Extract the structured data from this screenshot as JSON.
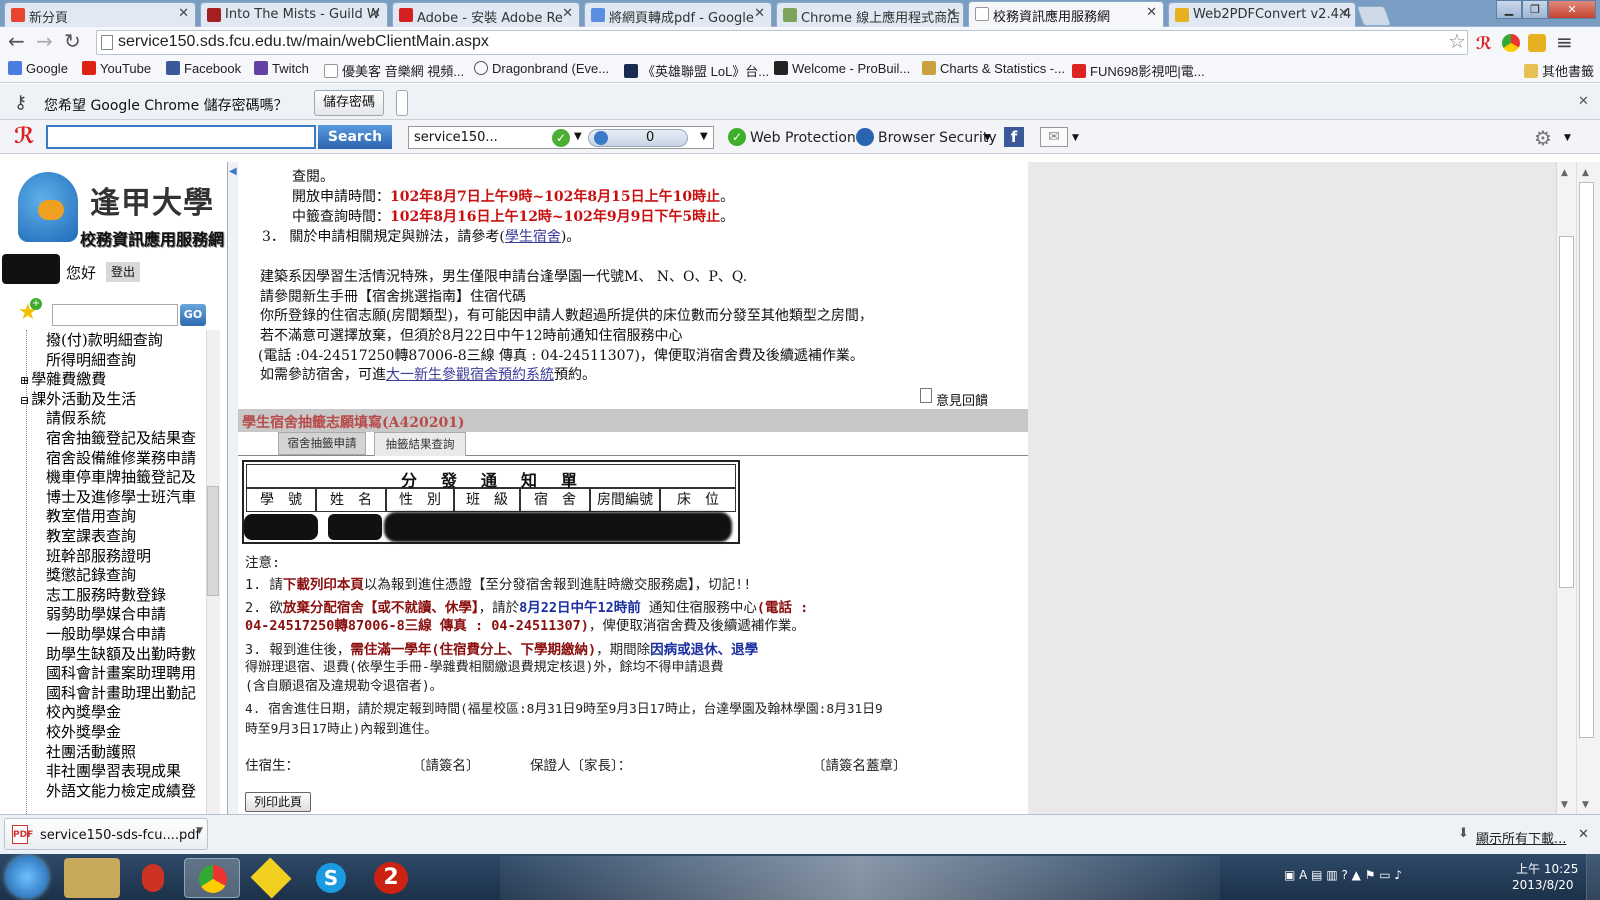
{
  "tabs": [
    {
      "title": "新分頁",
      "active": false
    },
    {
      "title": "Into The Mists - Guild W",
      "active": false
    },
    {
      "title": "Adobe - 安裝 Adobe Re",
      "active": false
    },
    {
      "title": "將網頁轉成pdf - Google",
      "active": false
    },
    {
      "title": "Chrome 線上應用程式商店",
      "active": false
    },
    {
      "title": "校務資訊應用服務網",
      "active": true
    },
    {
      "title": "Web2PDFConvert v2.4.4",
      "active": false
    }
  ],
  "address": {
    "url": "service150.sds.fcu.edu.tw/main/webClientMain.aspx"
  },
  "bookmarks": [
    "Google",
    "YouTube",
    "Facebook",
    "Twitch",
    "優美客 音樂網 視頻...",
    "Dragonbrand (Eve...",
    "《英雄聯盟 LoL》台...",
    "Welcome - ProBuil...",
    "Charts & Statistics -...",
    "FUN698影視吧|電...",
    "其他書籤"
  ],
  "password_bar": {
    "prompt": "您希望 Google Chrome 儲存密碼嗎？",
    "save_label": "儲存密碼"
  },
  "toolbar": {
    "search_label": "Search",
    "site_field": "service150...",
    "count": "0",
    "web_protection": "Web Protection",
    "browser_security": "Browser Security"
  },
  "sidebar": {
    "logo_text": "逢甲大學",
    "logo_subtitle": "校務資訊應用服務網",
    "greeting": "您好",
    "logout": "登出",
    "go_label": "GO",
    "tree_items": [
      {
        "label": "撥(付)款明細查詢",
        "type": "leaf"
      },
      {
        "label": "所得明細查詢",
        "type": "leaf"
      },
      {
        "label": "學雜費繳費",
        "type": "folder-closed"
      },
      {
        "label": "課外活動及生活",
        "type": "folder-open"
      },
      {
        "label": "請假系統",
        "type": "leaf"
      },
      {
        "label": "宿舍抽籤登記及結果查",
        "type": "leaf"
      },
      {
        "label": "宿舍設備維修業務申請",
        "type": "leaf"
      },
      {
        "label": "機車停車牌抽籤登記及",
        "type": "leaf"
      },
      {
        "label": "博士及進修學士班汽車",
        "type": "leaf"
      },
      {
        "label": "教室借用查詢",
        "type": "leaf"
      },
      {
        "label": "教室課表查詢",
        "type": "leaf"
      },
      {
        "label": "班幹部服務證明",
        "type": "leaf"
      },
      {
        "label": "獎懲記錄查詢",
        "type": "leaf"
      },
      {
        "label": "志工服務時數登錄",
        "type": "leaf"
      },
      {
        "label": "弱勢助學媒合申請",
        "type": "leaf"
      },
      {
        "label": "一般助學媒合申請",
        "type": "leaf"
      },
      {
        "label": "助學生缺額及出勤時數",
        "type": "leaf"
      },
      {
        "label": "國科會計畫案助理聘用",
        "type": "leaf"
      },
      {
        "label": "國科會計畫助理出勤記",
        "type": "leaf"
      },
      {
        "label": "校內獎學金",
        "type": "leaf"
      },
      {
        "label": "校外獎學金",
        "type": "leaf"
      },
      {
        "label": "社團活動護照",
        "type": "leaf"
      },
      {
        "label": "非社團學習表現成果",
        "type": "leaf"
      },
      {
        "label": "外語文能力檢定成績登",
        "type": "leaf"
      }
    ]
  },
  "content": {
    "line1": "查閱。",
    "open_label": "開放申請時間：",
    "open_time": "102年8月7日上午9時~102年8月15日上午10時止",
    "result_label": "中籤查詢時間：",
    "result_time": "102年8月16日上午12時~102年9月9日下午5時止",
    "item3_pre": "3． 關於申請相關規定與辦法，請參考(",
    "item3_link": "學生宿舍",
    "item3_post": ")。",
    "arch1": "建築系因學習生活情況特殊，男生僅限申請台逢學園一代號M、 N、O、P、Q.",
    "arch2": "請參閱新生手冊【宿舍挑選指南】住宿代碼",
    "arch3": "你所登錄的住宿志願(房間類型)，有可能因申請人數超過所提供的床位數而分發至其他類型之房間，",
    "arch4": "若不滿意可選擇放棄，但須於8月22日中午12時前通知住宿服務中心",
    "arch5": "(電話 :04-24517250轉87006-8三線 傳真 : 04-24511307)，俾便取消宿舍費及後續遞補作業。",
    "visit_pre": "如需參訪宿舍，可進",
    "visit_link": "大一新生參觀宿舍預約系統",
    "visit_post": "預約。",
    "feedback": "意見回饋",
    "section_title": "學生宿舍抽籤志願填寫(A420201)",
    "tab1": "宿舍抽籤申請",
    "tab2": "抽籤結果查詢",
    "table_title": "分　發　通　知　單",
    "table_headers": [
      "學　號",
      "姓　名",
      "性　別",
      "班　級",
      "宿　舍",
      "房間編號",
      "床　位"
    ],
    "notice_title": "注意:",
    "n1_a": "1. 請",
    "n1_b": "下載列印本頁",
    "n1_c": "以為報到進住憑證【至分發宿舍報到進駐時繳交服務處】，切記!!",
    "n2_a": "2. 欲",
    "n2_b": "放棄分配宿舍【或不就讀、休學】",
    "n2_c": "，請於",
    "n2_d": "8月22日中午12時前",
    "n2_e": " 通知住宿服務中心",
    "n2_f": "(電話 :",
    "n2_g": "04-24517250轉87006-8三線 傳真 : 04-24511307)",
    "n2_h": "，俾便取消宿舍費及後續遞補作業。",
    "n3_a": "3. 報到進住後，",
    "n3_b": "需住滿一學年(住宿費分上、下學期繳納)",
    "n3_c": "，期間除",
    "n3_d": "因病或退休、退學",
    "n3_e": "得辦理退宿、退費(依學生手冊-學雜費相關繳退費規定核退)外，餘均不得申請退費",
    "n3_f": "(含自願退宿及違規勒令退宿者)。",
    "n4_a": "4. 宿舍進住日期，請於規定報到時間(福星校區:8月31日9時至9月3日17時止，台達學園及翰林學園:8月31日9",
    "n4_b": "時至9月3日17時止)內報到進住。",
    "sign_resident": "住宿生：",
    "sign_resident_hint": "〔請簽名〕",
    "sign_guardian": "保證人〔家長〕：",
    "sign_guardian_hint": "〔請簽名蓋章〕",
    "print_label": "列印此頁"
  },
  "download_bar": {
    "file": "service150-sds-fcu....pdf",
    "show_all": "顯示所有下載..."
  },
  "taskbar": {
    "time": "上午 10:25",
    "date": "2013/8/20"
  }
}
